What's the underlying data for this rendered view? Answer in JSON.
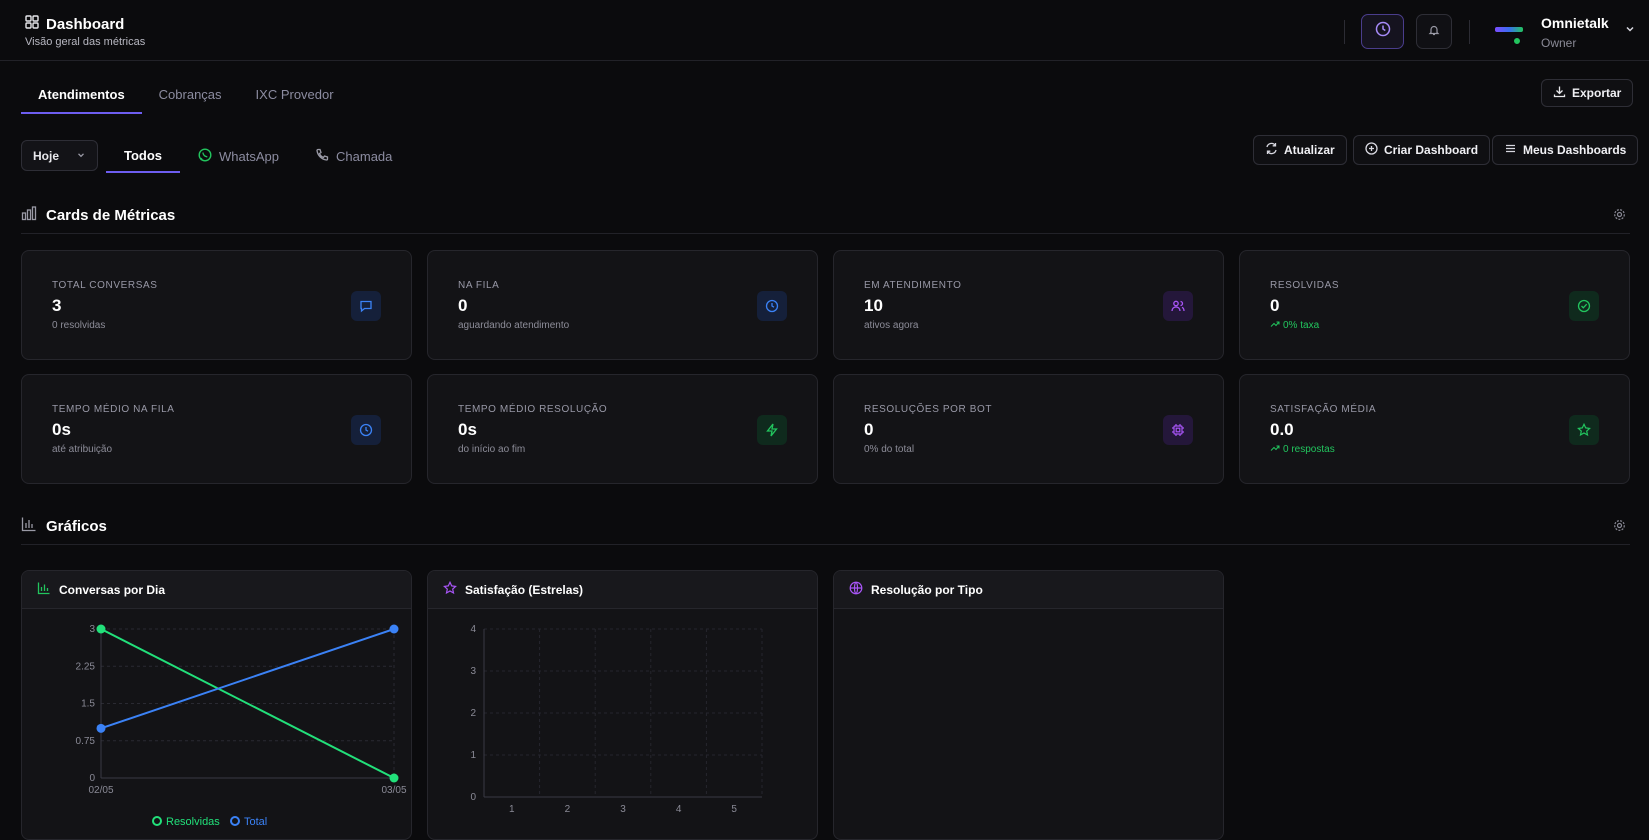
{
  "header": {
    "title": "Dashboard",
    "subtitle": "Visão geral das métricas",
    "user_name": "Omnietalk",
    "user_role": "Owner"
  },
  "tabs": [
    {
      "label": "Atendimentos",
      "active": true
    },
    {
      "label": "Cobranças",
      "active": false
    },
    {
      "label": "IXC Provedor",
      "active": false
    }
  ],
  "export_label": "Exportar",
  "period_select": "Hoje",
  "channels": [
    {
      "label": "Todos",
      "active": true
    },
    {
      "label": "WhatsApp",
      "icon": "whatsapp-icon"
    },
    {
      "label": "Chamada",
      "icon": "phone-icon"
    }
  ],
  "toolbar": {
    "refresh_label": "Atualizar",
    "create_label": "Criar Dashboard",
    "my_dashboards_label": "Meus Dashboards"
  },
  "sections": {
    "cards_title": "Cards de Métricas",
    "charts_title": "Gráficos"
  },
  "cards": [
    {
      "label": "TOTAL CONVERSAS",
      "value": "3",
      "sub": "0 resolvidas",
      "icon": "message-icon",
      "color": "#3b82f6"
    },
    {
      "label": "NA FILA",
      "value": "0",
      "sub": "aguardando atendimento",
      "icon": "clock-icon",
      "color": "#3b82f6"
    },
    {
      "label": "EM ATENDIMENTO",
      "value": "10",
      "sub": "ativos agora",
      "icon": "users-icon",
      "color": "#a855f7"
    },
    {
      "label": "RESOLVIDAS",
      "value": "0",
      "sub": "0% taxa",
      "icon": "check-circle-icon",
      "color": "#22c55e"
    },
    {
      "label": "TEMPO MÉDIO NA FILA",
      "value": "0s",
      "sub": "até atribuição",
      "icon": "clock-icon",
      "color": "#3b82f6"
    },
    {
      "label": "TEMPO MÉDIO RESOLUÇÃO",
      "value": "0s",
      "sub": "do início ao fim",
      "icon": "zap-icon",
      "color": "#22c55e"
    },
    {
      "label": "RESOLUÇÕES POR BOT",
      "value": "0",
      "sub": "0% do total",
      "icon": "cpu-icon",
      "color": "#a855f7"
    },
    {
      "label": "SATISFAÇÃO MÉDIA",
      "value": "0.0",
      "sub": "0 respostas",
      "icon": "star-icon",
      "color": "#22c55e"
    }
  ],
  "panels": {
    "conversations_title": "Conversas por Dia",
    "satisfaction_title": "Satisfação (Estrelas)",
    "resolution_title": "Resolução por Tipo"
  },
  "chart_data": [
    {
      "type": "line",
      "title": "Conversas por Dia",
      "categories": [
        "02/05",
        "03/05"
      ],
      "series": [
        {
          "name": "Resolvidas",
          "values": [
            3,
            0
          ],
          "color": "#22e07a"
        },
        {
          "name": "Total",
          "values": [
            1,
            3
          ],
          "color": "#3b82f6"
        }
      ],
      "yticks": [
        "0",
        "0.75",
        "1.5",
        "2.25",
        "3"
      ],
      "ylim": [
        0,
        3
      ],
      "grid": true,
      "legend": "bottom"
    },
    {
      "type": "bar",
      "title": "Satisfação (Estrelas)",
      "categories": [
        "1",
        "2",
        "3",
        "4",
        "5"
      ],
      "values": [
        0,
        0,
        0,
        0,
        0
      ],
      "yticks": [
        "0",
        "1",
        "2",
        "3",
        "4"
      ],
      "ylim": [
        0,
        4
      ],
      "grid": true
    }
  ]
}
